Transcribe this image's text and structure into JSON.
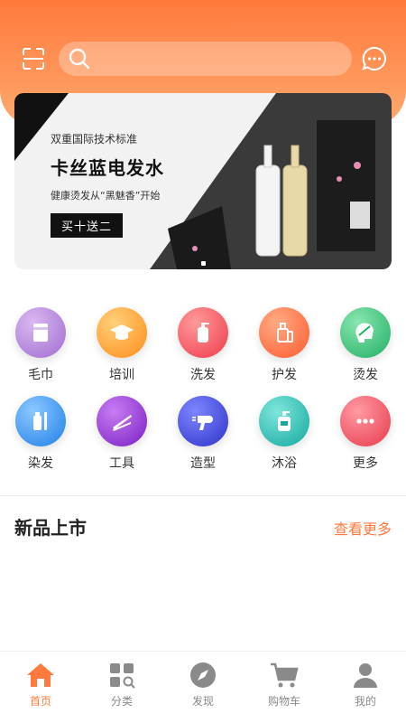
{
  "header": {
    "search_placeholder": "",
    "accent": "#ff7a3c"
  },
  "banner": {
    "subtitle": "双重国际技术标准",
    "title": "卡丝蓝电发水",
    "description": "健康烫发从“黑魅香”开始",
    "tag": "买十送二",
    "dot_count": 1
  },
  "categories": [
    {
      "label": "毛巾",
      "icon": "towel-icon",
      "color": "#b07fd6"
    },
    {
      "label": "培训",
      "icon": "graduation-cap-icon",
      "color": "#ff9b24"
    },
    {
      "label": "洗发",
      "icon": "shampoo-bottle-icon",
      "color": "#f4505a"
    },
    {
      "label": "护发",
      "icon": "conditioner-bottle-icon",
      "color": "#ff6a3d"
    },
    {
      "label": "烫发",
      "icon": "perm-head-icon",
      "color": "#34c27a"
    },
    {
      "label": "染发",
      "icon": "dye-brush-icon",
      "color": "#2f8ff0"
    },
    {
      "label": "工具",
      "icon": "hair-straightener-icon",
      "color": "#8b2fd0"
    },
    {
      "label": "造型",
      "icon": "hair-dryer-icon",
      "color": "#3b42d8"
    },
    {
      "label": "沐浴",
      "icon": "body-wash-icon",
      "color": "#26b8b0"
    },
    {
      "label": "更多",
      "icon": "more-dots-icon",
      "color": "#f04a5a"
    }
  ],
  "new_products": {
    "title": "新品上市",
    "more_label": "查看更多"
  },
  "tabbar": [
    {
      "label": "首页",
      "icon": "home-icon",
      "active": true
    },
    {
      "label": "分类",
      "icon": "category-icon",
      "active": false
    },
    {
      "label": "发现",
      "icon": "compass-icon",
      "active": false
    },
    {
      "label": "购物车",
      "icon": "cart-icon",
      "active": false
    },
    {
      "label": "我的",
      "icon": "user-icon",
      "active": false
    }
  ]
}
